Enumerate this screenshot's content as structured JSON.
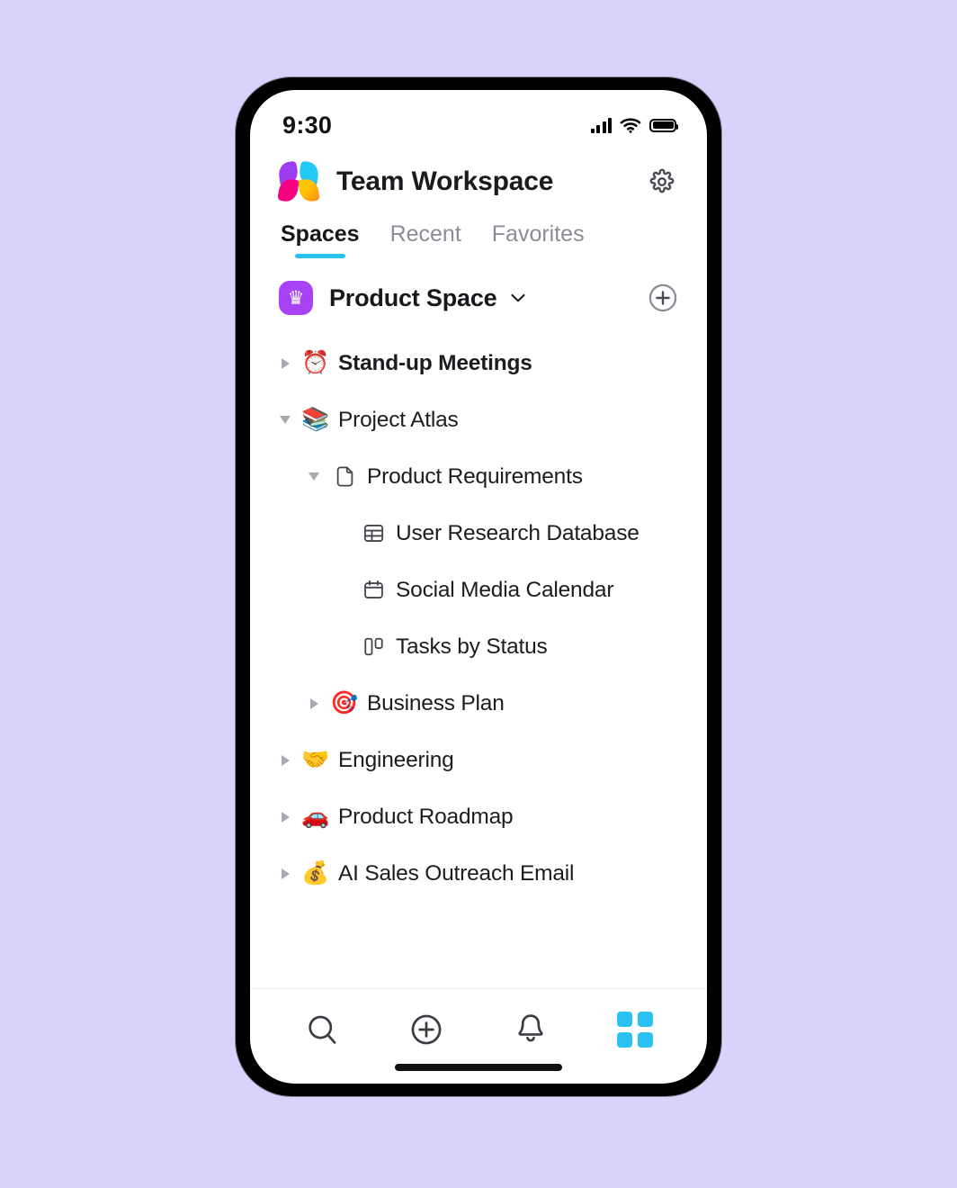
{
  "background_color": "#d7d3fb",
  "accent_color": "#29c2f2",
  "status_bar": {
    "time": "9:30",
    "signal_icon": "cellular-signal-icon",
    "wifi_icon": "wifi-icon",
    "battery_icon": "battery-full-icon"
  },
  "header": {
    "logo_icon": "app-logo-icon",
    "title": "Team Workspace",
    "settings_icon": "gear-icon"
  },
  "tabs": [
    {
      "label": "Spaces",
      "active": true
    },
    {
      "label": "Recent",
      "active": false
    },
    {
      "label": "Favorites",
      "active": false
    }
  ],
  "space": {
    "icon": "crown-icon",
    "icon_color": "#a743f5",
    "name": "Product Space",
    "chevron_icon": "chevron-down-icon",
    "add_icon": "plus-circle-icon"
  },
  "tree": [
    {
      "label": "Stand-up Meetings",
      "depth": 1,
      "toggle": "collapsed",
      "icon_type": "emoji",
      "icon": "⏰",
      "icon_name": "alarm-clock-emoji",
      "bold": true
    },
    {
      "label": "Project Atlas",
      "depth": 1,
      "toggle": "expanded",
      "icon_type": "emoji",
      "icon": "📚",
      "icon_name": "books-emoji",
      "bold": false
    },
    {
      "label": "Product Requirements",
      "depth": 2,
      "toggle": "expanded",
      "icon_type": "svg",
      "icon": "doc",
      "icon_name": "document-icon",
      "bold": false
    },
    {
      "label": "User Research Database",
      "depth": 3,
      "toggle": "none",
      "icon_type": "svg",
      "icon": "table",
      "icon_name": "table-icon",
      "bold": false
    },
    {
      "label": "Social Media Calendar",
      "depth": 3,
      "toggle": "none",
      "icon_type": "svg",
      "icon": "calendar",
      "icon_name": "calendar-icon",
      "bold": false
    },
    {
      "label": "Tasks by Status",
      "depth": 3,
      "toggle": "none",
      "icon_type": "svg",
      "icon": "board",
      "icon_name": "board-icon",
      "bold": false
    },
    {
      "label": "Business Plan",
      "depth": 2,
      "toggle": "collapsed",
      "icon_type": "emoji",
      "icon": "🎯",
      "icon_name": "dart-target-emoji",
      "bold": false
    },
    {
      "label": "Engineering",
      "depth": 1,
      "toggle": "collapsed",
      "icon_type": "emoji",
      "icon": "🤝",
      "icon_name": "handshake-emoji",
      "bold": false
    },
    {
      "label": "Product Roadmap",
      "depth": 1,
      "toggle": "collapsed",
      "icon_type": "emoji",
      "icon": "🚗",
      "icon_name": "car-emoji",
      "bold": false
    },
    {
      "label": "AI Sales Outreach Email",
      "depth": 1,
      "toggle": "collapsed",
      "icon_type": "emoji",
      "icon": "💰",
      "icon_name": "money-bag-emoji",
      "bold": false
    }
  ],
  "bottom_nav": [
    {
      "icon_name": "search-icon",
      "active": false
    },
    {
      "icon_name": "plus-circle-icon",
      "active": false
    },
    {
      "icon_name": "bell-icon",
      "active": false
    },
    {
      "icon_name": "grid-apps-icon",
      "active": true
    }
  ]
}
